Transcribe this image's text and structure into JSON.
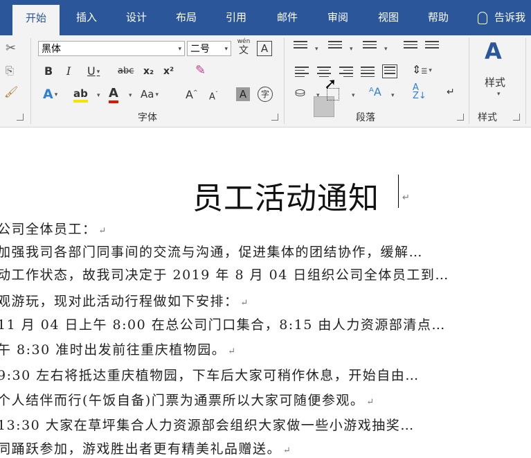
{
  "tabs": [
    {
      "label": "开始",
      "active": true
    },
    {
      "label": "插入"
    },
    {
      "label": "设计"
    },
    {
      "label": "布局"
    },
    {
      "label": "引用"
    },
    {
      "label": "邮件"
    },
    {
      "label": "审阅"
    },
    {
      "label": "视图"
    },
    {
      "label": "帮助"
    }
  ],
  "tell_me": "告诉我",
  "font": {
    "name": "黑体",
    "size": "二号",
    "group_label": "字体",
    "phonetic": "wén",
    "phonetic_char": "文",
    "border_char": "A",
    "bold": "B",
    "italic": "I",
    "underline": "U",
    "strike": "abc",
    "subscript": "x₂",
    "superscript": "x²",
    "effects": "A",
    "highlight": "ab",
    "font_color": "A",
    "case": "Aa",
    "grow": "A",
    "shrink": "A",
    "shade_char": "A",
    "enclose_char": "字"
  },
  "paragraph": {
    "group_label": "段落"
  },
  "styles": {
    "group_label": "样式",
    "button_label": "样式"
  },
  "document": {
    "title": "员工活动通知",
    "lines": [
      "公司全体员工：",
      "加强我司各部门同事间的交流与沟通，促进集体的团结协作，缓解…",
      "动工作状态，故我司决定于 2019 年 8 月 04 日组织公司全体员工到…",
      "观游玩，现对此活动行程做如下安排：",
      "11 月 04 日上午 8:00 在总公司门口集合，8:15 由人力资源部清点…",
      "午 8:30 准时出发前往重庆植物园。",
      "9:30 左右将抵达重庆植物园，下车后大家可稍作休息，开始自由…",
      "个人结伴而行(午饭自备)门票为通票所以大家可随便参观。",
      "13:30 大家在草坪集合人力资源部会组织大家做一些小游戏抽奖…",
      "同踊跃参加，游戏胜出者更有精美礼品赠送。"
    ],
    "paragraph_mark": "↵"
  },
  "colors": {
    "accent": "#2b579a",
    "highlight": "#f7e300",
    "font_red": "#e51400"
  }
}
